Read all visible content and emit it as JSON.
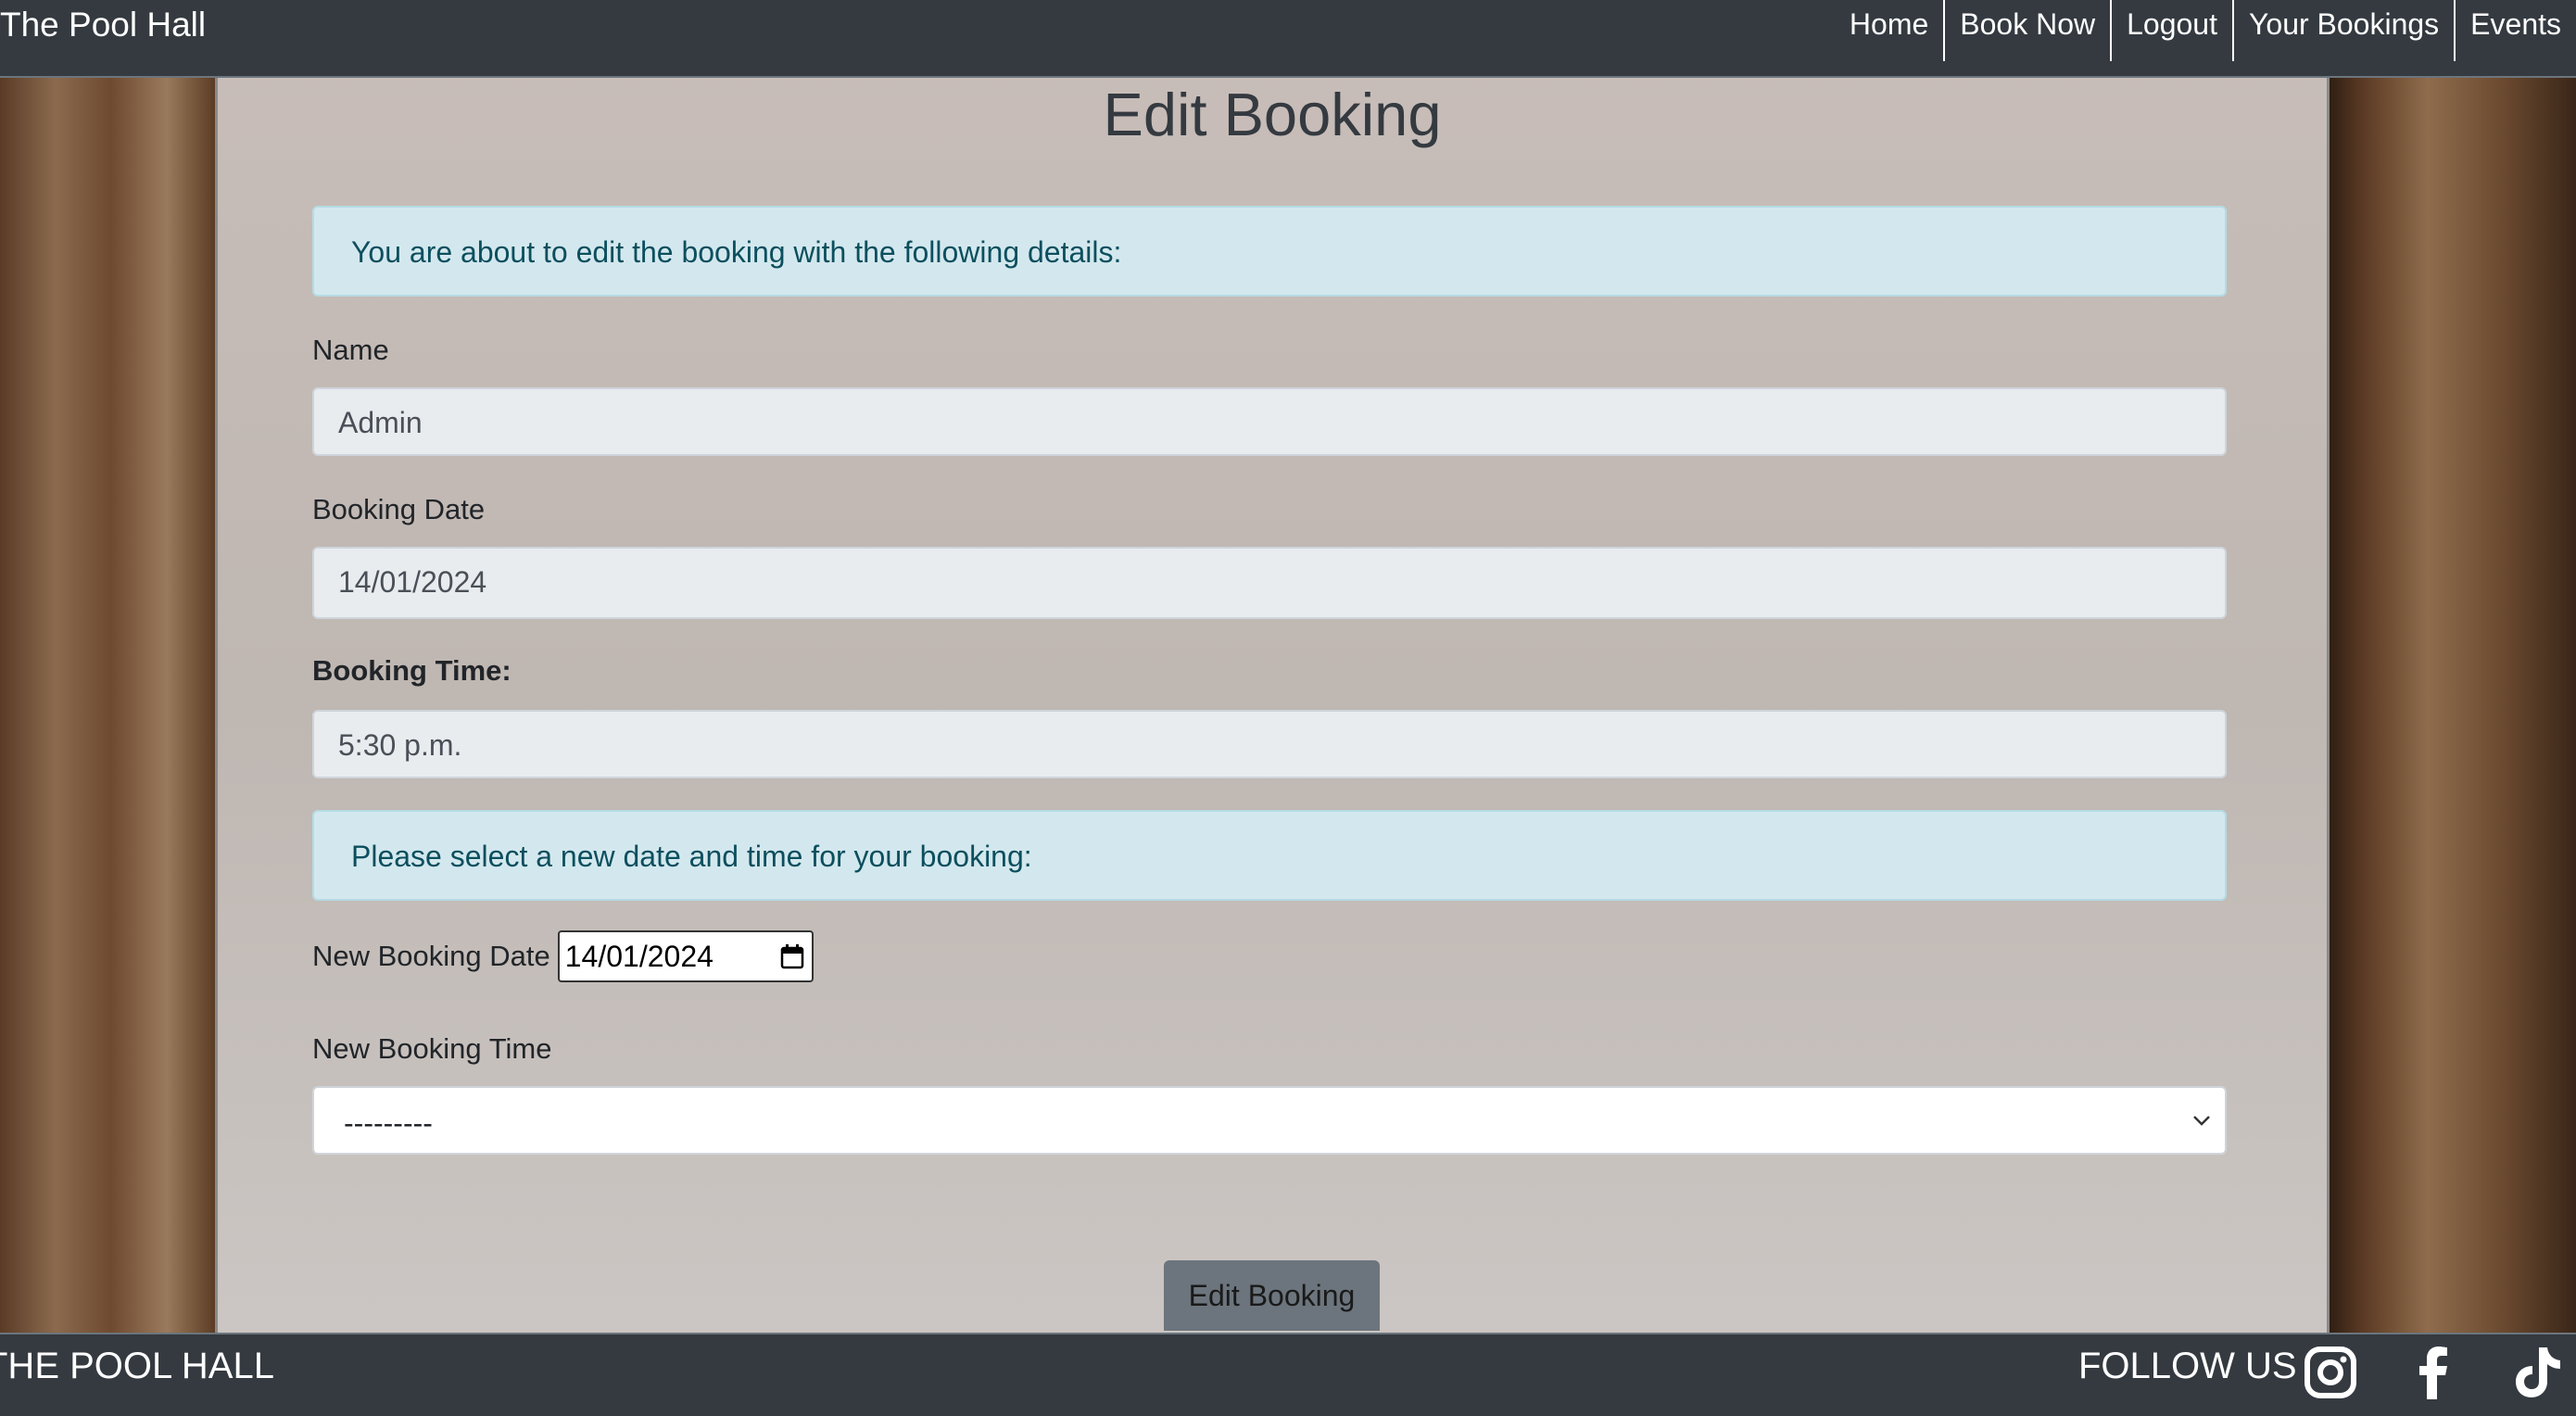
{
  "navbar": {
    "brand": "The Pool Hall",
    "links": [
      "Home",
      "Book Now",
      "Logout",
      "Your Bookings",
      "Events"
    ]
  },
  "page": {
    "title": "Edit Booking",
    "alert_current": "You are about to edit the booking with the following details:",
    "name_label": "Name",
    "name_value": "Admin",
    "date_label": "Booking Date",
    "date_value": "14/01/2024",
    "time_label": "Booking Time:",
    "time_value": "5:30 p.m.",
    "alert_new": "Please select a new date and time for your booking:",
    "new_date_label": "New Booking Date",
    "new_date_value": "14/01/2024",
    "new_time_label": "New Booking Time",
    "new_time_selected": "---------",
    "submit_label": "Edit Booking"
  },
  "footer": {
    "brand": "THE POOL HALL",
    "follow": "FOLLOW US",
    "social_icons": [
      "instagram-icon",
      "facebook-icon",
      "tiktok-icon"
    ]
  },
  "colors": {
    "navbar": "#343a40",
    "alert_bg": "#d3e8ee",
    "alert_text": "#0c4f5e",
    "button": "#6c757d"
  }
}
